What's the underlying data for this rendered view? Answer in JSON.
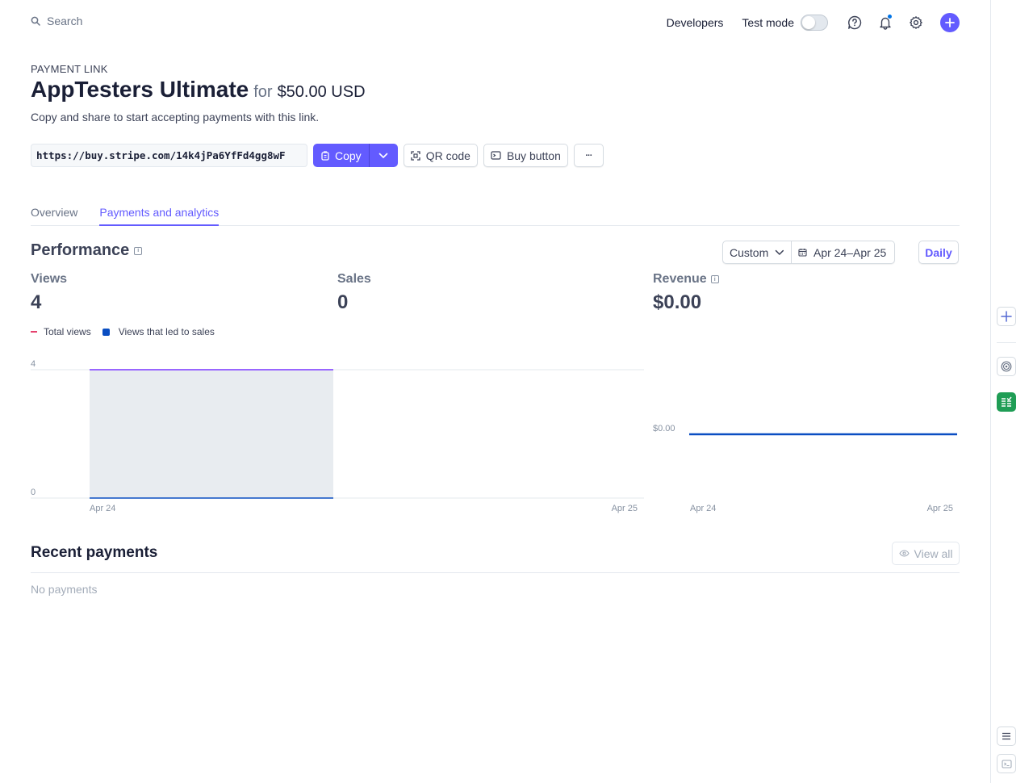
{
  "topbar": {
    "search_placeholder": "Search",
    "developers_label": "Developers",
    "test_mode_label": "Test mode",
    "test_mode_on": false
  },
  "header": {
    "eyebrow": "PAYMENT LINK",
    "title": "AppTesters Ultimate",
    "for_label": "for",
    "price": "$50.00 USD",
    "subtitle": "Copy and share to start accepting payments with this link."
  },
  "link": {
    "url": "https://buy.stripe.com/14k4jPa6YfFd4gg8wF",
    "copy_label": "Copy",
    "qr_label": "QR code",
    "buy_button_label": "Buy button",
    "more_label": "···"
  },
  "tabs": [
    {
      "label": "Overview",
      "active": false
    },
    {
      "label": "Payments and analytics",
      "active": true
    }
  ],
  "performance": {
    "title": "Performance",
    "range_mode": "Custom",
    "date_range": "Apr 24–Apr 25",
    "granularity": "Daily",
    "metrics": {
      "views": {
        "label": "Views",
        "value": "4"
      },
      "sales": {
        "label": "Sales",
        "value": "0"
      },
      "revenue": {
        "label": "Revenue",
        "value": "$0.00"
      }
    },
    "legend": {
      "total_views": "Total views",
      "views_to_sales": "Views that led to sales"
    }
  },
  "chart_data": [
    {
      "type": "area",
      "categories": [
        "Apr 24",
        "Apr 25"
      ],
      "series": [
        {
          "name": "Total views",
          "values": [
            4,
            4
          ]
        },
        {
          "name": "Views that led to sales",
          "values": [
            0,
            0
          ]
        }
      ],
      "y_ticks": [
        "4",
        "0"
      ],
      "ylim": [
        0,
        4
      ],
      "grid": true,
      "legend_position": "top-left",
      "colors": {
        "total_views": "#9966ff",
        "views_to_sales": "#0a4ec2",
        "fill": "#e8ecf0"
      }
    },
    {
      "type": "line",
      "categories": [
        "Apr 24",
        "Apr 25"
      ],
      "series": [
        {
          "name": "Revenue",
          "values": [
            0,
            0
          ]
        }
      ],
      "y_ticks": [
        "$0.00"
      ],
      "colors": {
        "revenue": "#0a4ec2"
      }
    }
  ],
  "recent_payments": {
    "title": "Recent payments",
    "view_all_label": "View all",
    "empty_text": "No payments"
  },
  "colors": {
    "accent": "#635bff",
    "text": "#1a1f36",
    "muted": "#697386",
    "border": "#e3e8ee"
  }
}
